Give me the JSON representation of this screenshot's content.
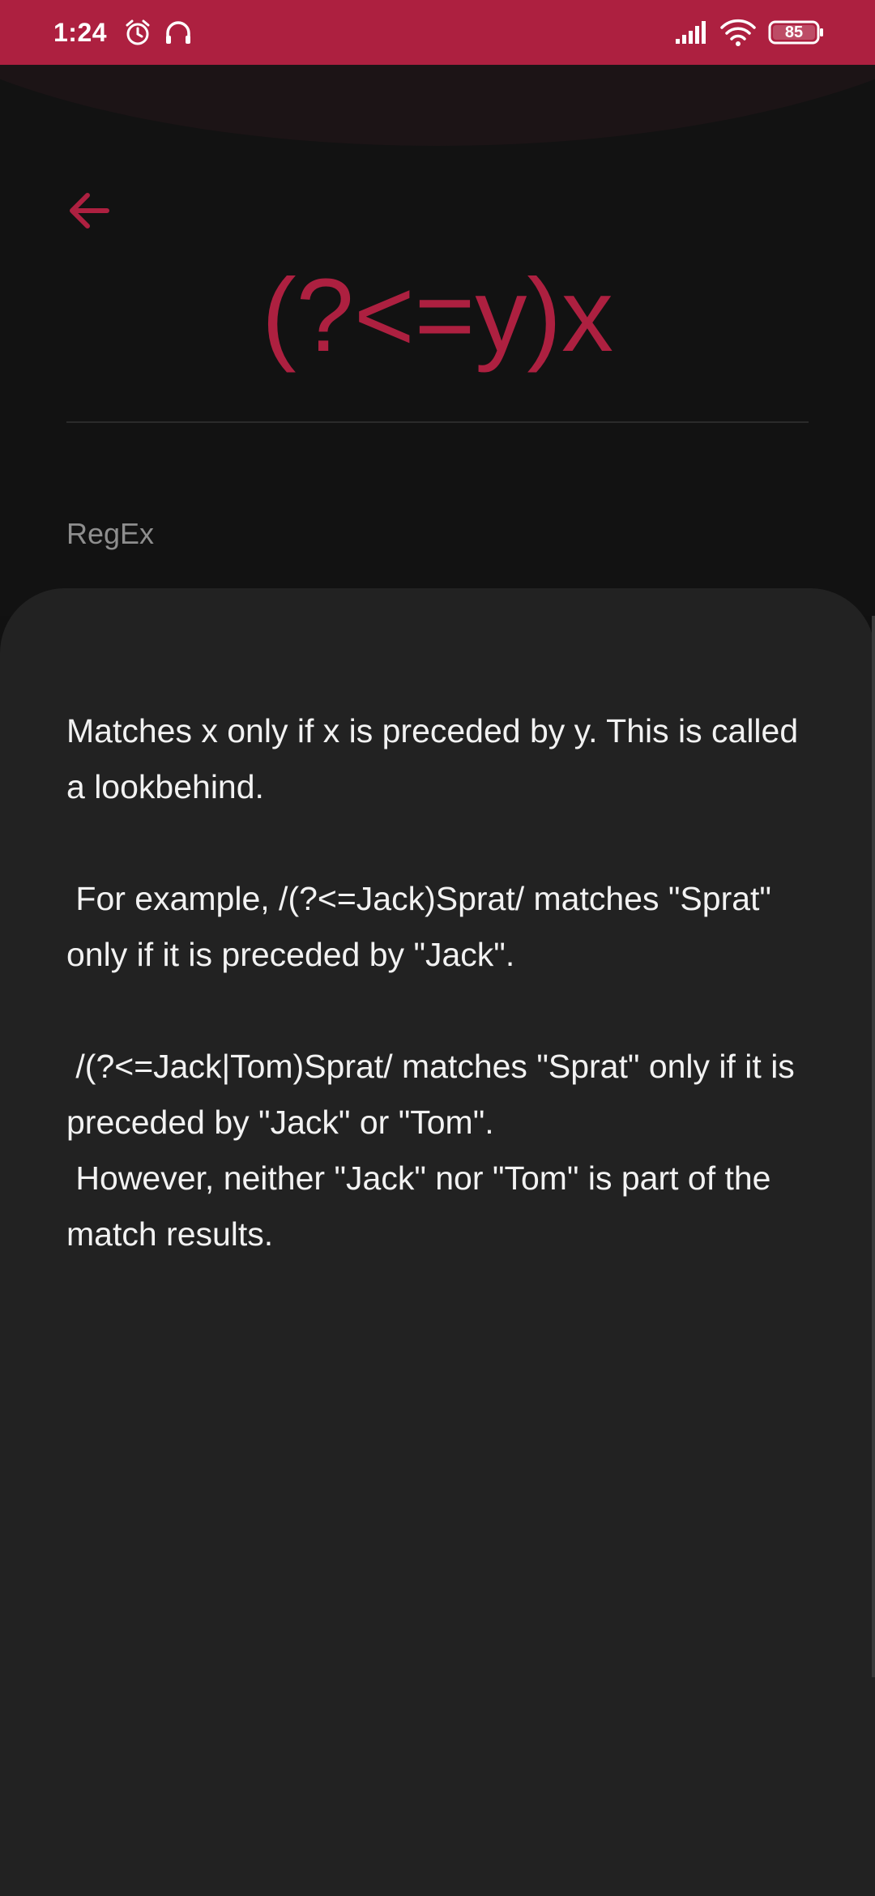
{
  "status_bar": {
    "time": "1:24",
    "battery": "85",
    "icons": [
      "alarm-icon",
      "headphones-icon",
      "signal-icon",
      "wifi-icon",
      "battery-icon"
    ],
    "background_color": "#AD2040"
  },
  "header": {
    "back_icon": "arrow-left-icon",
    "title": "(?<=y)x",
    "category": "RegEx",
    "accent_color": "#AD2040"
  },
  "content": {
    "description": "Matches x only if x is preceded by y. This is called a lookbehind.\n\n For example, /(?<=Jack)Sprat/ matches \"Sprat\" only if it is preceded by \"Jack\".\n\n /(?<=Jack|Tom)Sprat/ matches \"Sprat\" only if it is preceded by \"Jack\" or \"Tom\".\n However, neither \"Jack\" nor \"Tom\" is part of the match results."
  }
}
